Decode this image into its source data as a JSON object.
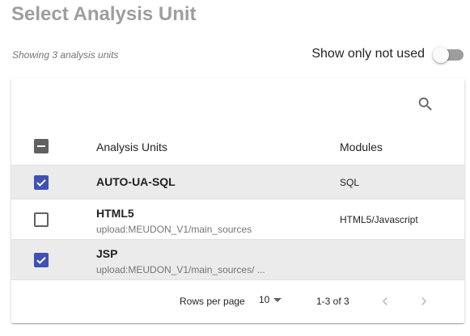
{
  "header": {
    "title": "Select Analysis Unit",
    "showing_text": "Showing 3 analysis units"
  },
  "filter": {
    "toggle_label": "Show only not used",
    "toggle_on": false
  },
  "table": {
    "columns": [
      "Analysis Units",
      "Modules"
    ],
    "select_all_state": "indeterminate",
    "rows": [
      {
        "name": "AUTO-UA-SQL",
        "path": "",
        "module": "SQL",
        "checked": true
      },
      {
        "name": "HTML5",
        "path": "upload:MEUDON_V1/main_sources",
        "module": "HTML5/Javascript",
        "checked": false
      },
      {
        "name": "JSP",
        "path": "upload:MEUDON_V1/main_sources/ ...",
        "module": "",
        "checked": true
      }
    ]
  },
  "pagination": {
    "rows_per_page_label": "Rows per page",
    "rows_per_page_value": "10",
    "range_text": "1-3 of 3"
  },
  "colors": {
    "accent": "#3f51b5",
    "title_gray": "#9e9e9e",
    "selected_row_bg": "#ebebeb"
  },
  "icons": {
    "search": "search-icon",
    "dropdown": "arrow-drop-down-icon",
    "prev": "chevron-left-icon",
    "next": "chevron-right-icon"
  }
}
